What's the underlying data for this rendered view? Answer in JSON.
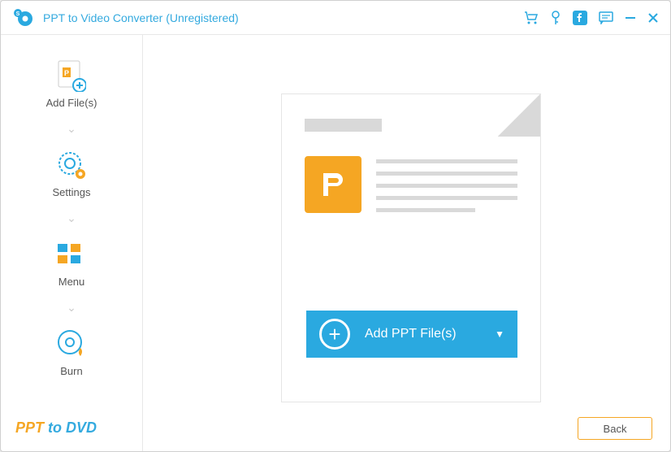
{
  "titlebar": {
    "title": "PPT to Video Converter (Unregistered)"
  },
  "sidebar": {
    "items": [
      {
        "label": "Add File(s)"
      },
      {
        "label": "Settings"
      },
      {
        "label": "Menu"
      },
      {
        "label": "Burn"
      }
    ],
    "brand_part1": "PPT ",
    "brand_part2": "to DVD"
  },
  "main": {
    "add_button_label": "Add PPT File(s)"
  },
  "footer": {
    "back_label": "Back"
  }
}
